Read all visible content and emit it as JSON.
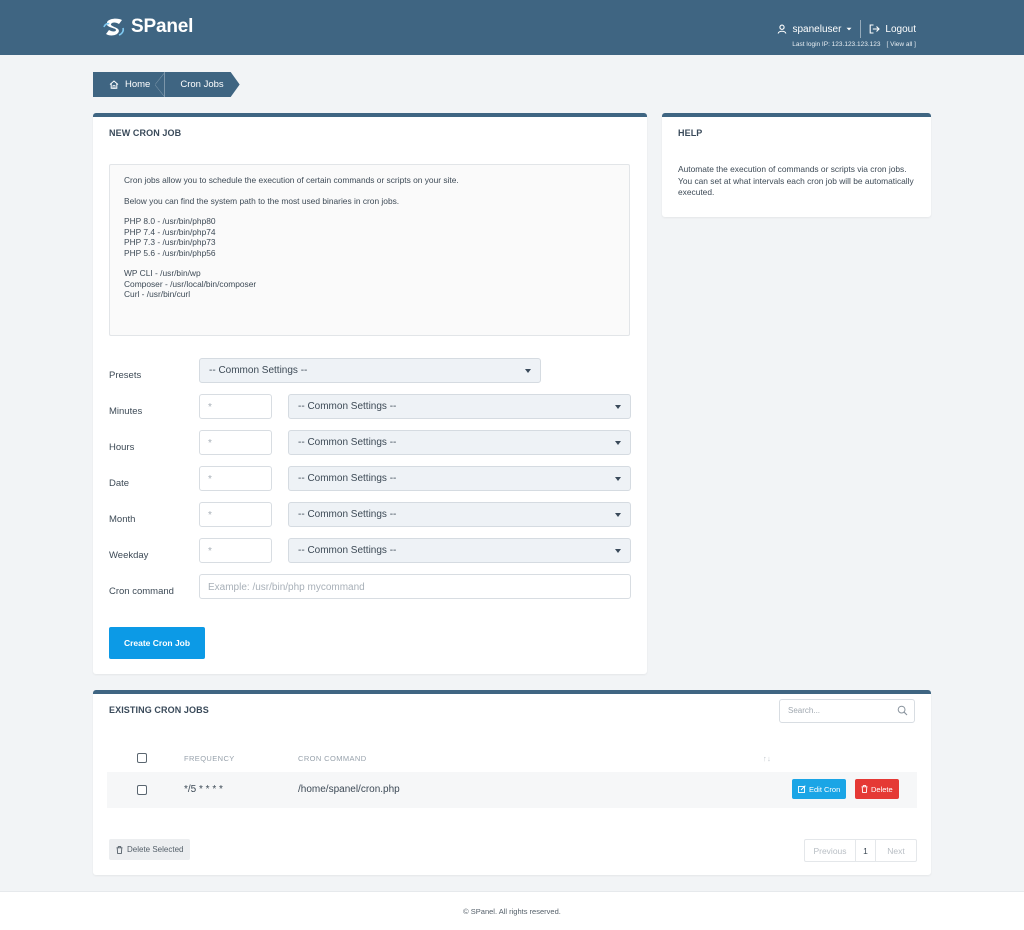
{
  "app": {
    "name": "SPanel"
  },
  "header": {
    "username": "spaneluser",
    "logout_label": "Logout",
    "last_login_label": "Last login IP: 123.123.123.123",
    "view_all_label": "[ View all ]"
  },
  "breadcrumb": {
    "home": "Home",
    "current": "Cron Jobs"
  },
  "new_cron": {
    "title": "NEW CRON JOB",
    "info": {
      "intro": "Cron jobs allow you to schedule the execution of certain commands or scripts on your site.",
      "paths_intro": "Below you can find the system path to the most used binaries in cron jobs.",
      "php_paths": [
        "PHP 8.0 - /usr/bin/php80",
        "PHP 7.4 - /usr/bin/php74",
        "PHP 7.3 - /usr/bin/php73",
        "PHP 5.6 - /usr/bin/php56"
      ],
      "tool_paths": [
        "WP CLI - /usr/bin/wp",
        "Composer - /usr/local/bin/composer",
        "Curl - /usr/bin/curl"
      ]
    },
    "presets": {
      "label": "Presets",
      "value": "-- Common Settings --"
    },
    "fields": [
      {
        "label": "Minutes",
        "value": "*",
        "select": "-- Common Settings --"
      },
      {
        "label": "Hours",
        "value": "*",
        "select": "-- Common Settings --"
      },
      {
        "label": "Date",
        "value": "*",
        "select": "-- Common Settings --"
      },
      {
        "label": "Month",
        "value": "*",
        "select": "-- Common Settings --"
      },
      {
        "label": "Weekday",
        "value": "*",
        "select": "-- Common Settings --"
      }
    ],
    "command": {
      "label": "Cron command",
      "placeholder": "Example: /usr/bin/php mycommand"
    },
    "submit_label": "Create Cron Job"
  },
  "help": {
    "title": "HELP",
    "text": "Automate the execution of commands or scripts via cron jobs. You can set at what intervals each cron job will be automatically executed."
  },
  "existing": {
    "title": "EXISTING CRON JOBS",
    "search_placeholder": "Search...",
    "columns": {
      "frequency": "FREQUENCY",
      "command": "CRON COMMAND",
      "sort": "↑↓"
    },
    "rows": [
      {
        "frequency": "*/5 * * * *",
        "command": "/home/spanel/cron.php",
        "edit_label": "Edit Cron",
        "delete_label": "Delete"
      }
    ],
    "delete_selected_label": "Delete Selected",
    "pagination": {
      "previous": "Previous",
      "page": "1",
      "next": "Next"
    }
  },
  "footer": {
    "text": "© SPanel. All rights reserved."
  },
  "colors": {
    "brand": "#3f6582",
    "primary": "#0c9ae6",
    "edit": "#1aa5e6",
    "danger": "#e53935"
  },
  "icons": [
    "spanel-logo-icon",
    "user-icon",
    "chevron-down-icon",
    "logout-icon",
    "home-icon",
    "search-icon",
    "edit-icon",
    "trash-icon"
  ]
}
